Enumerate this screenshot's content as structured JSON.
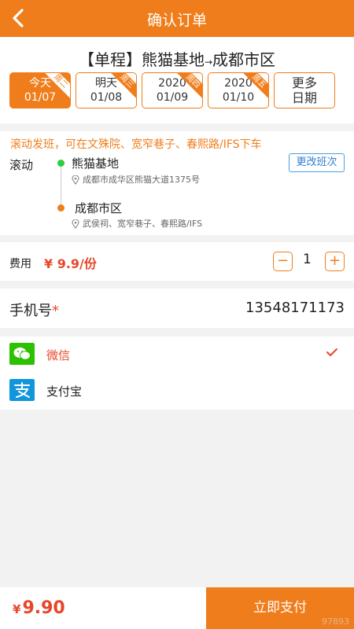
{
  "header": {
    "title": "确认订单",
    "back_icon": "chevron-left-icon"
  },
  "route": {
    "type_label": "【单程】",
    "from": "熊猫基地",
    "arrow": "→",
    "to": "成都市区"
  },
  "dates": [
    {
      "top": "今天",
      "bottom": "01/07",
      "tag": "周二",
      "active": true
    },
    {
      "top": "明天",
      "bottom": "01/08",
      "tag": "周三",
      "active": false
    },
    {
      "top": "2020",
      "bottom": "01/09",
      "tag": "周四",
      "active": false
    },
    {
      "top": "2020",
      "bottom": "01/10",
      "tag": "周五",
      "active": false
    },
    {
      "top": "更多",
      "bottom": "日期"
    }
  ],
  "trip": {
    "notice": "滚动发班，可在文殊院、宽窄巷子、春熙路/IFS下车",
    "mode": "滚动",
    "change_label": "更改班次",
    "origin": {
      "name": "熊猫基地",
      "address": "成都市成华区熊猫大道1375号"
    },
    "destination": {
      "name": "成都市区",
      "address": "武侯祠、宽窄巷子、春熙路/IFS"
    }
  },
  "fee": {
    "label": "费用",
    "price": "¥ 9.9/份",
    "minus": "−",
    "plus": "+",
    "quantity": "1"
  },
  "phone": {
    "label": "手机号",
    "required_mark": "*",
    "value": "13548171173"
  },
  "payment": [
    {
      "name": "微信",
      "selected": true,
      "color": "#e8462a",
      "icon": "wechat-icon",
      "icon_color": "#2dc100"
    },
    {
      "name": "支付宝",
      "selected": false,
      "color": "#222222",
      "icon": "alipay-icon",
      "icon_color": "#1296db"
    }
  ],
  "footer": {
    "currency": "¥",
    "total": "9.90",
    "pay_label": "立即支付",
    "watermark": "97893"
  },
  "colors": {
    "accent": "#f07d1b",
    "price": "#e8462a",
    "link": "#2f7fd0"
  }
}
